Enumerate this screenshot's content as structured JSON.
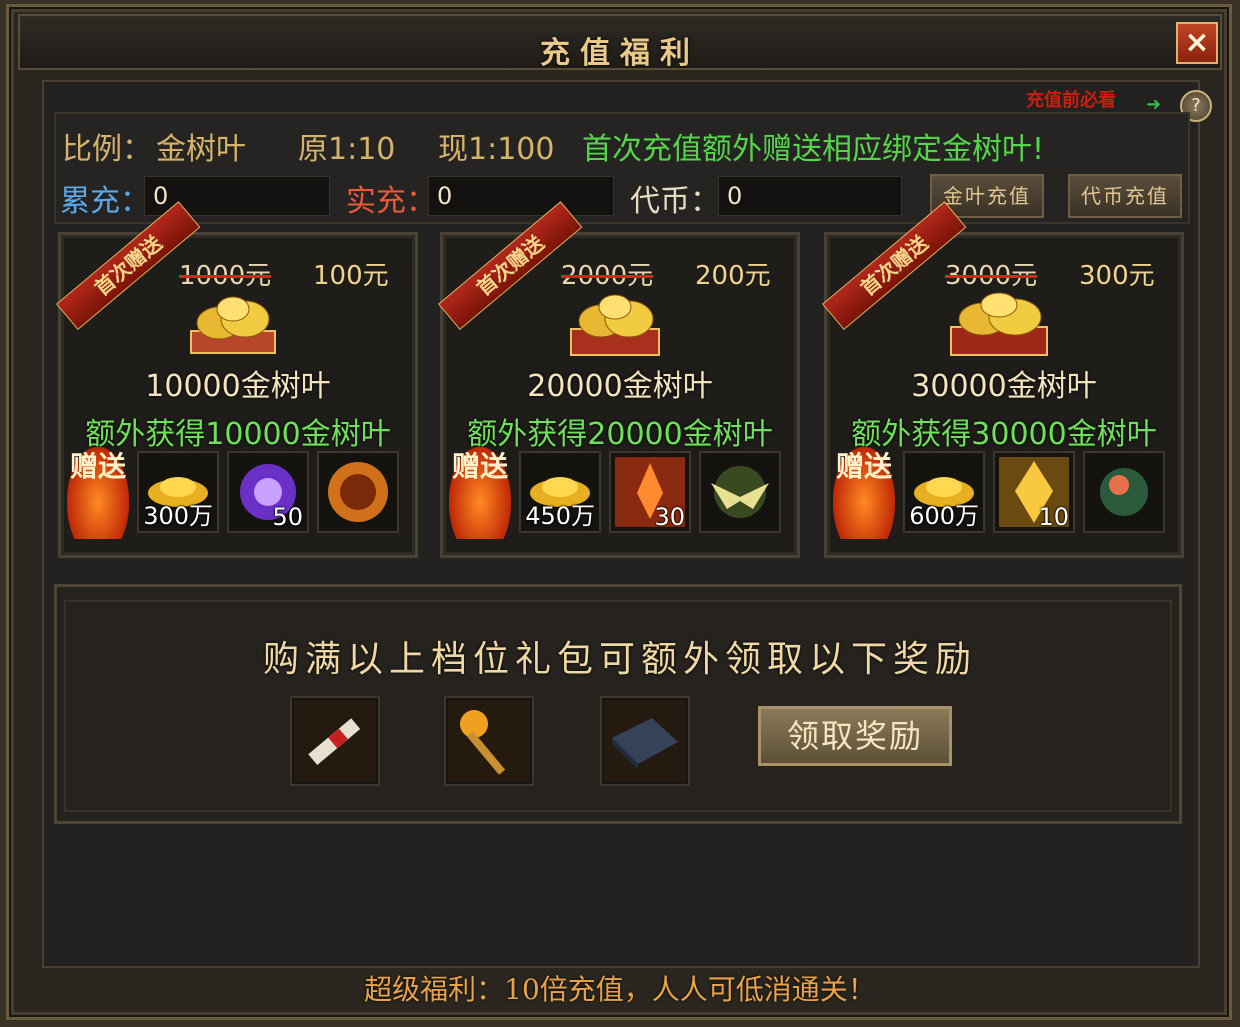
{
  "window": {
    "title": "充值福利",
    "close_icon": "×"
  },
  "help": {
    "text": "充值前必看",
    "arrow": "➜",
    "icon": "?"
  },
  "ratio": {
    "label": "比例：",
    "currency": "金树叶",
    "original": "原1:10",
    "current": "现1:100",
    "notice": "首次充值额外赠送相应绑定金树叶!"
  },
  "balances": {
    "total_label": "累充：",
    "total_value": "0",
    "real_label": "实充：",
    "real_value": "0",
    "token_label": "代币：",
    "token_value": "0"
  },
  "buttons": {
    "gold_recharge": "金叶充值",
    "token_recharge": "代币充值",
    "claim": "领取奖励"
  },
  "packages": [
    {
      "ribbon": "首次赠送",
      "old_price": "1000元",
      "new_price": "100元",
      "amount": "10000金树叶",
      "extra": "额外获得10000金树叶",
      "gift_label": "赠送",
      "items": [
        {
          "icon": "gold-ingot-icon",
          "count": "300万"
        },
        {
          "icon": "purple-gem-icon",
          "count": "50"
        },
        {
          "icon": "fire-orb-icon",
          "count": ""
        }
      ]
    },
    {
      "ribbon": "首次赠送",
      "old_price": "2000元",
      "new_price": "200元",
      "amount": "20000金树叶",
      "extra": "额外获得20000金树叶",
      "gift_label": "赠送",
      "items": [
        {
          "icon": "gold-ingot-icon",
          "count": "450万"
        },
        {
          "icon": "flame-crystal-icon",
          "count": "30"
        },
        {
          "icon": "wings-icon",
          "count": ""
        }
      ]
    },
    {
      "ribbon": "首次赠送",
      "old_price": "3000元",
      "new_price": "300元",
      "amount": "30000金树叶",
      "extra": "额外获得30000金树叶",
      "gift_label": "赠送",
      "items": [
        {
          "icon": "gold-ingot-icon",
          "count": "600万"
        },
        {
          "icon": "golden-leaf-icon",
          "count": "10"
        },
        {
          "icon": "green-orb-icon",
          "count": ""
        }
      ]
    }
  ],
  "bonus": {
    "title": "购满以上档位礼包可额外领取以下奖励",
    "items": [
      "scroll-icon",
      "golden-staff-icon",
      "book-icon"
    ]
  },
  "footer": "超级福利：10倍充值，人人可低消通关！",
  "colors": {
    "accent_gold": "#e8c98a",
    "green": "#55d64a",
    "red": "#c81f10"
  }
}
